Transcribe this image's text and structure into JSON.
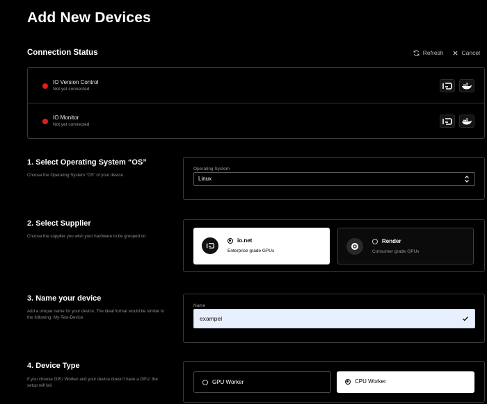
{
  "page": {
    "title": "Add New Devices"
  },
  "connection": {
    "title": "Connection Status",
    "refresh_label": "Refresh",
    "cancel_label": "Cancel",
    "items": [
      {
        "name": "IO Version Control",
        "status": "Not yet connected",
        "status_color": "#e11d1d"
      },
      {
        "name": "IO Monitor",
        "status": "Not yet connected",
        "status_color": "#e11d1d"
      }
    ]
  },
  "os_section": {
    "title": "1. Select Operating System “OS”",
    "description": "Choose the Operating System “OS” of your device",
    "field_label": "Operating System",
    "selected_value": "Linux"
  },
  "supplier_section": {
    "title": "2. Select Supplier",
    "description": "Choose the supplier you wish your hardware to be grouped on",
    "options": [
      {
        "name": "io.net",
        "subtitle": "Enterprise grade GPUs",
        "selected": true,
        "icon": "io-net-logo-icon"
      },
      {
        "name": "Render",
        "subtitle": "Consumer grade GPUs",
        "selected": false,
        "icon": "render-logo-icon"
      }
    ]
  },
  "name_section": {
    "title": "3. Name your device",
    "description": "Add a unique name for your device, The ideal format would be similar to the following: My-Test-Device",
    "field_label": "Name",
    "value": "exampel"
  },
  "type_section": {
    "title": "4. Device Type",
    "description": "If you choose GPU Worker and your device doesn't have a GPU, the setup will fail",
    "options": [
      {
        "label": "GPU Worker",
        "selected": false
      },
      {
        "label": "CPU Worker",
        "selected": true
      }
    ]
  },
  "colors": {
    "background": "#000000",
    "border": "#3a3a3a",
    "status_red": "#e11d1d",
    "input_bg": "#e9f0fd"
  }
}
